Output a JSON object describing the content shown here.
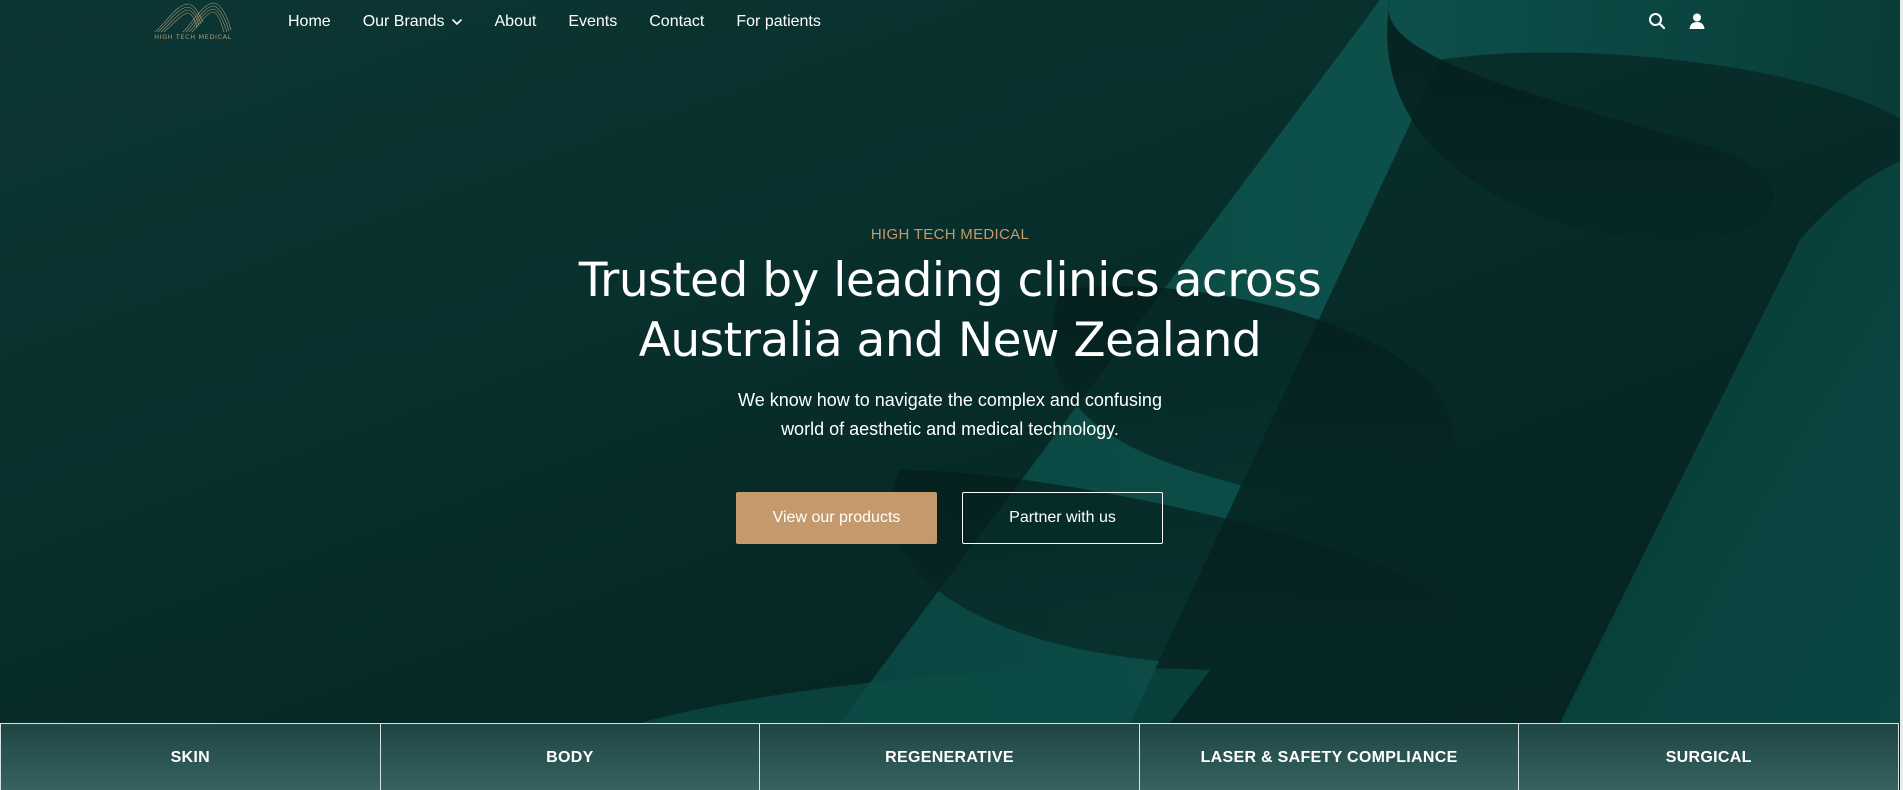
{
  "brand": {
    "logo_text": "HIGH TECH MEDICAL",
    "accent_color": "#c49a6c",
    "background_color": "#08302d"
  },
  "nav": {
    "items": [
      {
        "label": "Home"
      },
      {
        "label": "Our Brands",
        "has_dropdown": true
      },
      {
        "label": "About"
      },
      {
        "label": "Events"
      },
      {
        "label": "Contact"
      },
      {
        "label": "For patients"
      }
    ],
    "icons": [
      "search-icon",
      "account-icon"
    ]
  },
  "hero": {
    "eyebrow": "HIGH TECH MEDICAL",
    "headline_line1": "Trusted by leading clinics across",
    "headline_line2": "Australia and New Zealand",
    "subtext_line1": "We know how to navigate the complex and confusing",
    "subtext_line2": "world of aesthetic and medical technology.",
    "primary_button": "View our products",
    "secondary_button": "Partner with us"
  },
  "categories": [
    {
      "label": "SKIN"
    },
    {
      "label": "BODY"
    },
    {
      "label": "REGENERATIVE"
    },
    {
      "label": "LASER & SAFETY COMPLIANCE"
    },
    {
      "label": "SURGICAL"
    }
  ]
}
